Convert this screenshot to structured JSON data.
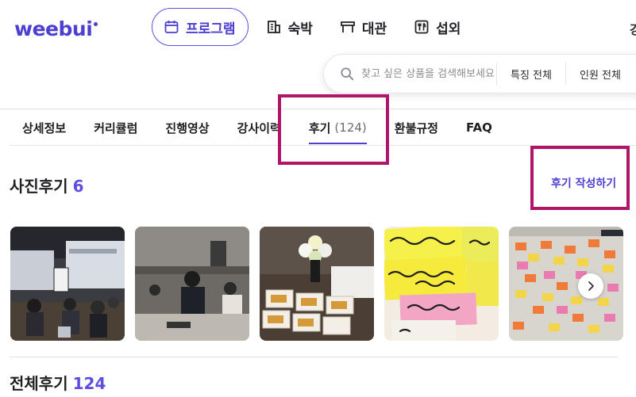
{
  "brand": {
    "logo_text": "weebui",
    "color": "#4d3fd1"
  },
  "top_nav": {
    "items": [
      {
        "label": "프로그램",
        "icon": "calendar-icon",
        "active": true
      },
      {
        "label": "숙박",
        "icon": "building-icon",
        "active": false
      },
      {
        "label": "대관",
        "icon": "venue-icon",
        "active": false
      },
      {
        "label": "섭외",
        "icon": "utensils-icon",
        "active": false
      }
    ],
    "cut_off_text": "강"
  },
  "search": {
    "placeholder": "찾고 싶은 상품을 검색해보세요",
    "filters": [
      "특징 전체",
      "인원 전체"
    ]
  },
  "tabs": [
    {
      "label": "상세정보",
      "count": ""
    },
    {
      "label": "커리큘럼",
      "count": ""
    },
    {
      "label": "진행영상",
      "count": ""
    },
    {
      "label": "강사이력",
      "count": ""
    },
    {
      "label": "후기",
      "count": "(124)",
      "active": true
    },
    {
      "label": "환불규정",
      "count": ""
    },
    {
      "label": "FAQ",
      "count": ""
    }
  ],
  "photo_reviews": {
    "title": "사진후기",
    "count": "6",
    "write_link": "후기 작성하기",
    "photos": [
      {
        "name": "photo-seminar-presentation"
      },
      {
        "name": "photo-workshop-room"
      },
      {
        "name": "photo-lunchbox-flowers"
      },
      {
        "name": "photo-handwritten-notes"
      },
      {
        "name": "photo-sticky-notes-board"
      }
    ],
    "next_icon": "chevron-right-icon"
  },
  "all_reviews": {
    "title": "전체후기",
    "count": "124"
  },
  "colors": {
    "accent": "#5b4ee0",
    "highlight": "#b0156a"
  }
}
